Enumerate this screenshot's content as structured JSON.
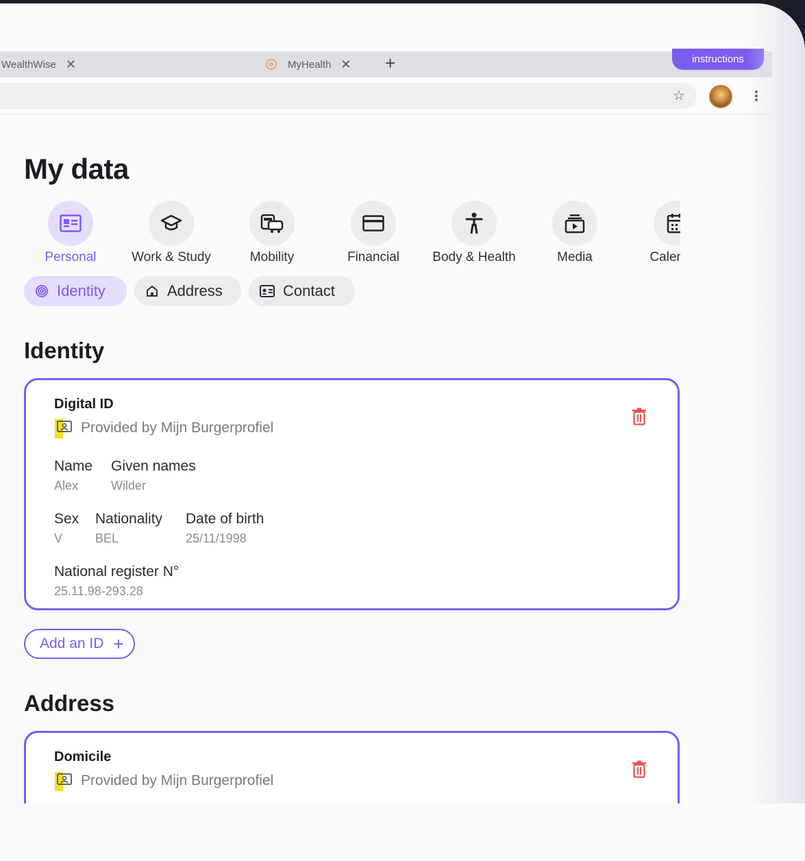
{
  "browser": {
    "tabs": [
      {
        "label": "WealthWise"
      },
      {
        "label": "MyHealth"
      }
    ],
    "new_tab": "+",
    "close_glyph": "✕",
    "instructions_label": "instructions",
    "star_glyph": "☆",
    "kebab_glyph": "⋮"
  },
  "page": {
    "title": "My data"
  },
  "categories": [
    {
      "label": "Personal",
      "icon": "id-card-icon",
      "active": true
    },
    {
      "label": "Work & Study",
      "icon": "graduation-cap-icon"
    },
    {
      "label": "Mobility",
      "icon": "vehicles-icon"
    },
    {
      "label": "Financial",
      "icon": "credit-card-icon"
    },
    {
      "label": "Body & Health",
      "icon": "person-icon"
    },
    {
      "label": "Media",
      "icon": "media-play-icon"
    },
    {
      "label": "Calendar",
      "icon": "calendar-icon"
    }
  ],
  "subtabs": [
    {
      "label": "Identity",
      "icon": "fingerprint-icon",
      "active": true
    },
    {
      "label": "Address",
      "icon": "home-icon"
    },
    {
      "label": "Contact",
      "icon": "contact-card-icon"
    }
  ],
  "identity": {
    "section_title": "Identity",
    "card": {
      "title": "Digital ID",
      "provider": "Provided by Mijn Burgerprofiel",
      "fields": {
        "name": {
          "label": "Name",
          "value": "Alex"
        },
        "given_names": {
          "label": "Given names",
          "value": "Wilder"
        },
        "sex": {
          "label": "Sex",
          "value": "V"
        },
        "nationality": {
          "label": "Nationality",
          "value": "BEL"
        },
        "dob": {
          "label": "Date of birth",
          "value": "25/11/1998"
        },
        "register": {
          "label": "National register N°",
          "value": "25.11.98-293.28"
        }
      }
    },
    "add_button": "Add an ID",
    "add_plus": "+"
  },
  "address": {
    "section_title": "Address",
    "card": {
      "title": "Domicile",
      "provider": "Provided by Mijn Burgerprofiel"
    }
  },
  "colors": {
    "accent": "#7a5cf0",
    "accent_soft": "#e4ddfb",
    "delete": "#e8524a",
    "provider_highlight": "#f5df1f"
  }
}
